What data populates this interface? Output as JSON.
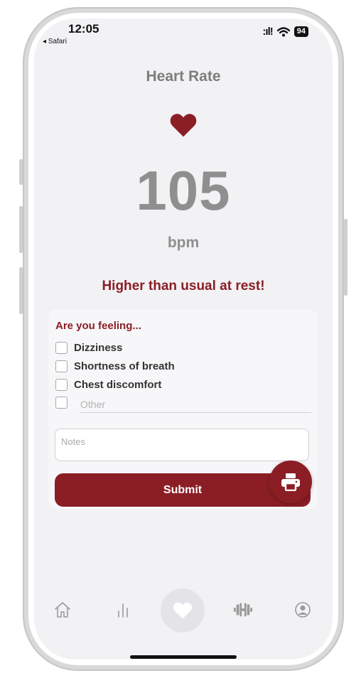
{
  "status_bar": {
    "time": "12:05",
    "back_app": "◂ Safari",
    "signal": ":ıl!",
    "battery": "94"
  },
  "header": {
    "title": "Heart Rate"
  },
  "reading": {
    "value": "105",
    "unit": "bpm",
    "alert": "Higher than usual at rest!"
  },
  "symptoms": {
    "title": "Are you feeling...",
    "options": [
      {
        "label": "Dizziness",
        "checked": false
      },
      {
        "label": "Shortness of breath",
        "checked": false
      },
      {
        "label": "Chest discomfort",
        "checked": false
      }
    ],
    "other_placeholder": "Other",
    "notes_placeholder": "Notes",
    "submit_label": "Submit"
  },
  "colors": {
    "accent": "#8b1e25",
    "muted_text": "#8f8f8f",
    "background": "#f2f2f5"
  },
  "nav": {
    "items": [
      "home-icon",
      "chart-icon",
      "heart-icon",
      "dumbbell-icon",
      "profile-icon"
    ],
    "active": "heart-icon"
  }
}
